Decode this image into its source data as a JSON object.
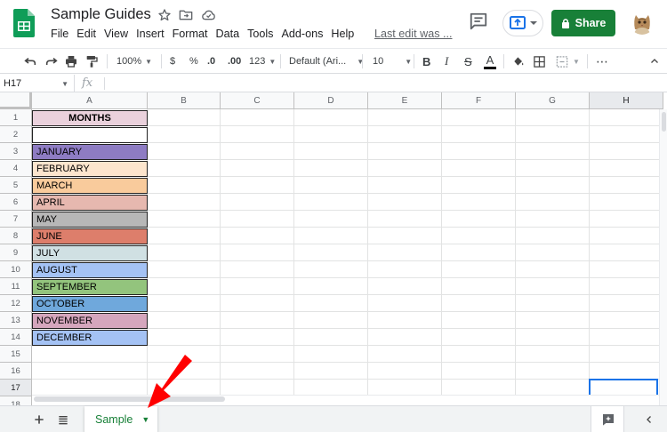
{
  "app": {
    "title": "Sample Guides",
    "menu": [
      "File",
      "Edit",
      "View",
      "Insert",
      "Format",
      "Data",
      "Tools",
      "Add-ons",
      "Help"
    ],
    "last_edit": "Last edit was ...",
    "share_label": "Share",
    "brand_color": "#188038"
  },
  "toolbar": {
    "zoom": "100%",
    "currency": "$",
    "percent": "%",
    "decrease_decimal": ".0",
    "increase_decimal": ".00",
    "more_formats": "123",
    "font": "Default (Ari...",
    "font_size": "10",
    "bold": "B",
    "italic": "I",
    "strike": "S",
    "text_color": "A",
    "more": "⋯"
  },
  "formula_bar": {
    "name_box": "H17",
    "fx": "fx",
    "value": ""
  },
  "grid": {
    "columns": [
      "A",
      "B",
      "C",
      "D",
      "E",
      "F",
      "G",
      "H"
    ],
    "rows": [
      "1",
      "2",
      "3",
      "4",
      "5",
      "6",
      "7",
      "8",
      "9",
      "10",
      "11",
      "12",
      "13",
      "14",
      "15",
      "16",
      "17",
      "18"
    ],
    "selected_cell": "H17",
    "cells": [
      {
        "text": "MONTHS",
        "color": "#ead1dc"
      },
      {
        "text": "",
        "color": "#ffffff"
      },
      {
        "text": "JANUARY",
        "color": "#8e7cc3"
      },
      {
        "text": "FEBRUARY",
        "color": "#fce5cd"
      },
      {
        "text": "MARCH",
        "color": "#f9cb9c"
      },
      {
        "text": "APRIL",
        "color": "#e6b8af"
      },
      {
        "text": "MAY",
        "color": "#b7b7b7"
      },
      {
        "text": "JUNE",
        "color": "#dd7e6b"
      },
      {
        "text": "JULY",
        "color": "#d0e0e3"
      },
      {
        "text": "AUGUST",
        "color": "#a4c2f4"
      },
      {
        "text": "SEPTEMBER",
        "color": "#93c47d"
      },
      {
        "text": "OCTOBER",
        "color": "#6fa8dc"
      },
      {
        "text": "NOVEMBER",
        "color": "#d5a6bd"
      },
      {
        "text": "DECEMBER",
        "color": "#a4c2f4"
      }
    ]
  },
  "sheets": {
    "tabs": [
      {
        "label": "Sample",
        "active": true
      }
    ]
  },
  "annotation": {
    "arrow_color": "#ff0000"
  }
}
